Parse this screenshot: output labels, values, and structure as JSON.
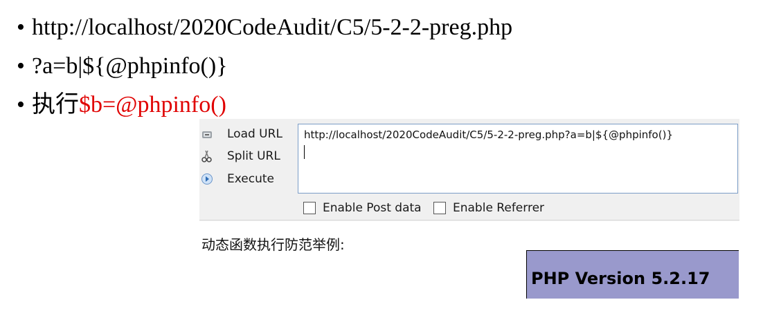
{
  "slide": {
    "bullets": [
      {
        "text": "http://localhost/2020CodeAudit/C5/5-2-2-preg.php"
      },
      {
        "text": "?a=b|${@phpinfo()}"
      },
      {
        "prefix": "执行",
        "highlight": "$b=@phpinfo()"
      }
    ],
    "bullet_glyph": "•",
    "highlight_color": "#e00000"
  },
  "hackbar": {
    "buttons": [
      {
        "label": "Load URL",
        "icon": "load-url-icon"
      },
      {
        "label": "Split URL",
        "icon": "scissors-icon"
      },
      {
        "label": "Execute",
        "icon": "execute-arrow-icon"
      }
    ],
    "url_value": "http://localhost/2020CodeAudit/C5/5-2-2-preg.php?a=b|${@phpinfo()}",
    "enable_post_label": "Enable Post data",
    "enable_referrer_label": "Enable Referrer"
  },
  "page": {
    "caption": "动态函数执行防范举例:",
    "php_version": "PHP Version 5.2.17",
    "php_banner_color": "#9999cc"
  }
}
